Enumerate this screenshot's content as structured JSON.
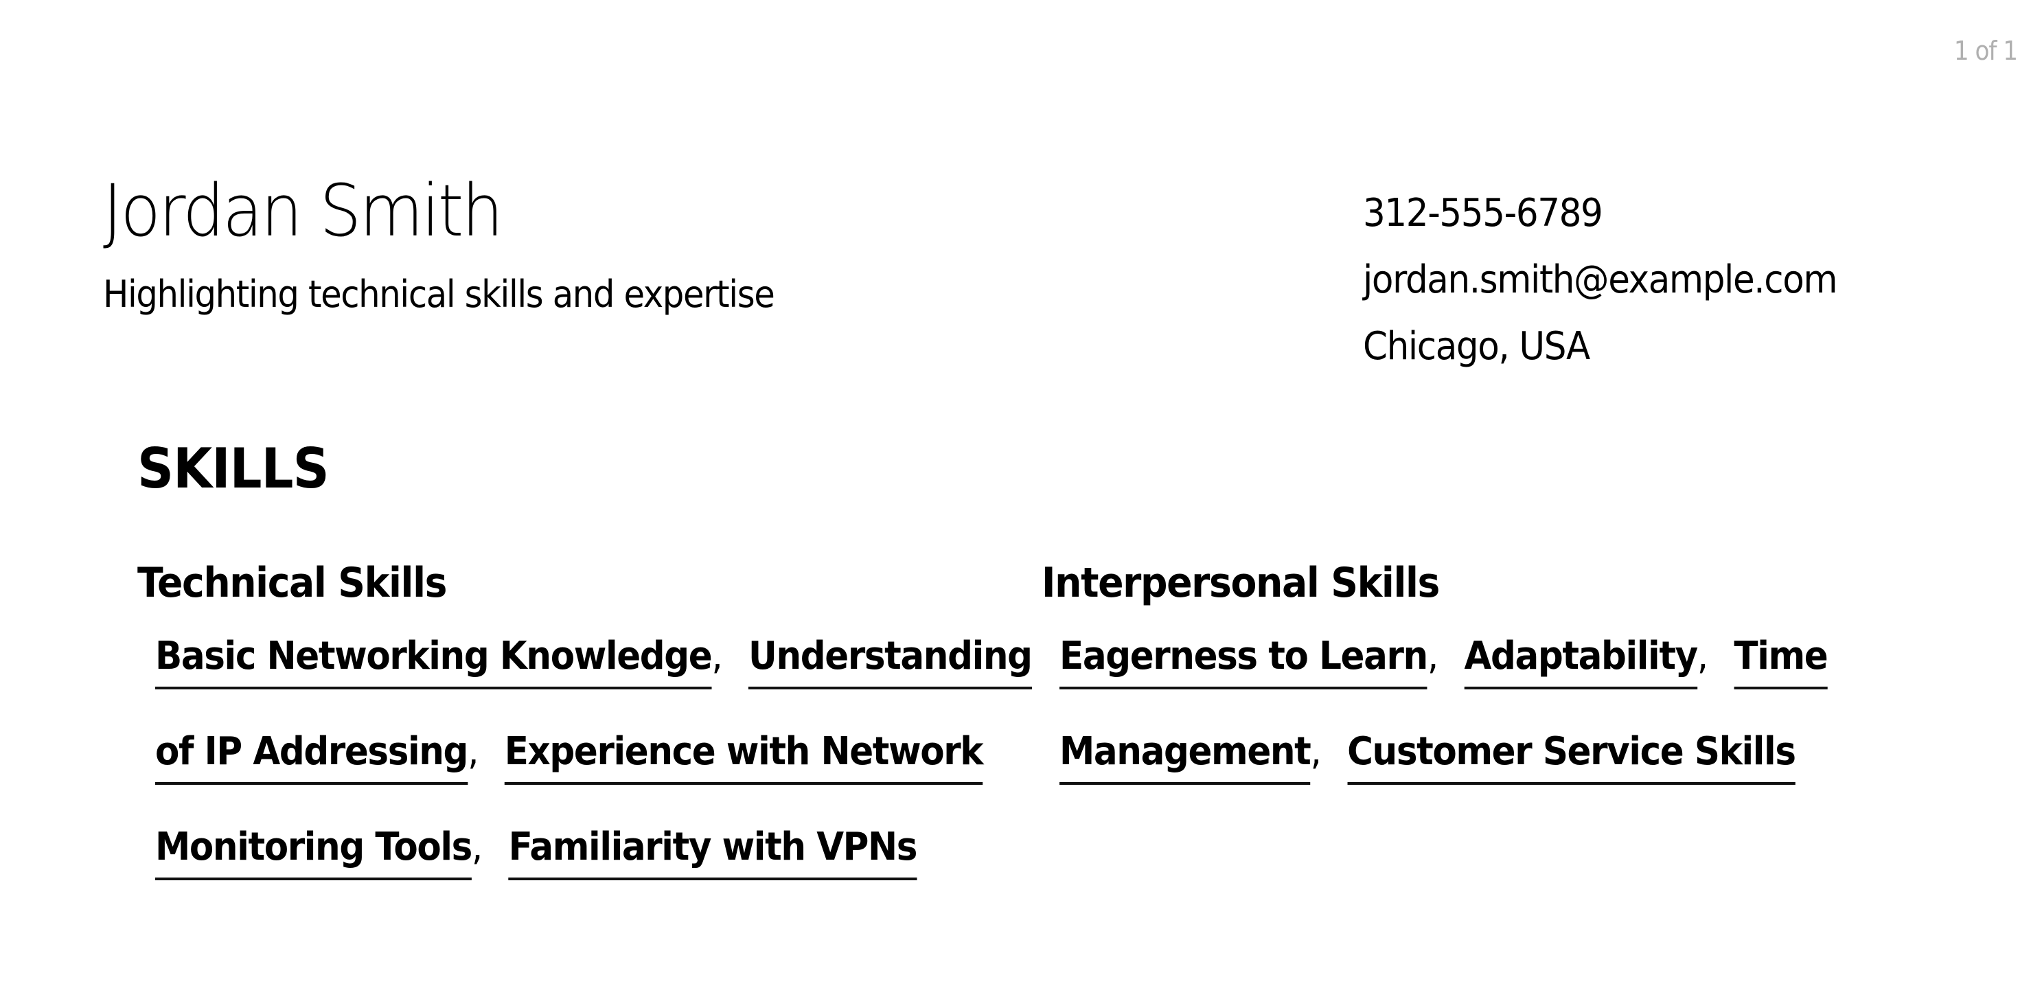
{
  "page_counter": "1 of 1",
  "header": {
    "name": "Jordan Smith",
    "tagline": "Highlighting technical skills and expertise"
  },
  "contact": {
    "phone": "312-555-6789",
    "email": "jordan.smith@example.com",
    "location": "Chicago, USA"
  },
  "skills": {
    "title": "SKILLS",
    "groups": [
      {
        "title": "Technical Skills",
        "lines": [
          [
            {
              "text": "Basic Networking Knowledge",
              "sep": ","
            },
            {
              "text": "Understanding",
              "sep": ""
            }
          ],
          [
            {
              "text": "of IP Addressing",
              "sep": ","
            },
            {
              "text": "Experience with Network",
              "sep": ""
            }
          ],
          [
            {
              "text": "Monitoring Tools",
              "sep": ","
            },
            {
              "text": "Familiarity with VPNs",
              "sep": ""
            }
          ]
        ]
      },
      {
        "title": "Interpersonal Skills",
        "lines": [
          [
            {
              "text": "Eagerness to Learn",
              "sep": ","
            },
            {
              "text": "Adaptability",
              "sep": ","
            },
            {
              "text": "Time",
              "sep": ""
            }
          ],
          [
            {
              "text": "Management",
              "sep": ","
            },
            {
              "text": "Customer Service Skills",
              "sep": ""
            }
          ]
        ]
      }
    ]
  }
}
